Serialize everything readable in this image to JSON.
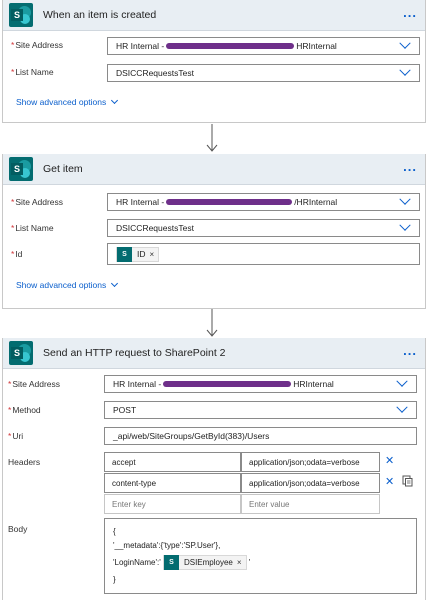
{
  "cards": [
    {
      "title": "When an item is created",
      "site_address_label": "Site Address",
      "site_address_prefix": "HR Internal -",
      "site_address_suffix": "HRInternal",
      "list_name_label": "List Name",
      "list_name_value": "DSICCRequestsTest",
      "advanced_label": "Show advanced options"
    },
    {
      "title": "Get item",
      "site_address_label": "Site Address",
      "site_address_prefix": "HR Internal -",
      "site_address_suffix": "/HRInternal",
      "list_name_label": "List Name",
      "list_name_value": "DSICCRequestsTest",
      "id_label": "Id",
      "id_token": "ID",
      "advanced_label": "Show advanced options"
    },
    {
      "title": "Send an HTTP request to SharePoint 2",
      "site_address_label": "Site Address",
      "site_address_prefix": "HR Internal -",
      "site_address_suffix": "HRInternal",
      "method_label": "Method",
      "method_value": "POST",
      "uri_label": "Uri",
      "uri_value": "_api/web/SiteGroups/GetById(383)/Users",
      "headers_label": "Headers",
      "headers": [
        {
          "key": "accept",
          "value": "application/json;odata=verbose"
        },
        {
          "key": "content-type",
          "value": "application/json;odata=verbose"
        }
      ],
      "key_placeholder": "Enter key",
      "value_placeholder": "Enter value",
      "body_label": "Body",
      "body_line1": "{",
      "body_line2": "'__metadata':{'type':'SP.User'},",
      "body_line3_prefix": "'LoginName':'",
      "body_token": "DSIEmployee",
      "body_line3_suffix": "'",
      "body_line4": "}"
    }
  ],
  "more_label": "...",
  "required_marker": "*",
  "token_close": "×",
  "colors": {
    "accent": "#0b5fcc",
    "header_bg": "#e8eef3",
    "sharepoint": "#036c70",
    "redaction": "#6e2f8a"
  }
}
